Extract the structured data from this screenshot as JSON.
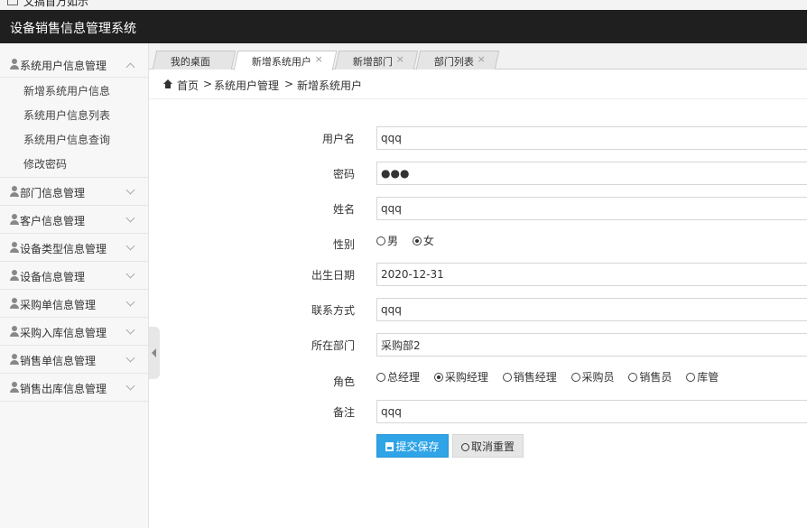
{
  "window": {
    "title": "文搞首万如示"
  },
  "header": {
    "app_title": "设备销售信息管理系统"
  },
  "sidebar": {
    "groups": [
      {
        "label": "系统用户信息管理",
        "expanded": true,
        "items": [
          "新增系统用户信息",
          "系统用户信息列表",
          "系统用户信息查询",
          "修改密码"
        ]
      },
      {
        "label": "部门信息管理"
      },
      {
        "label": "客户信息管理"
      },
      {
        "label": "设备类型信息管理"
      },
      {
        "label": "设备信息管理"
      },
      {
        "label": "采购单信息管理"
      },
      {
        "label": "采购入库信息管理"
      },
      {
        "label": "销售单信息管理"
      },
      {
        "label": "销售出库信息管理"
      }
    ]
  },
  "tabs": [
    {
      "label": "我的桌面",
      "closable": false
    },
    {
      "label": "新增系统用户",
      "closable": true,
      "active": true
    },
    {
      "label": "新增部门",
      "closable": true
    },
    {
      "label": "部门列表",
      "closable": true
    }
  ],
  "tab_close_glyph": "×",
  "breadcrumb": {
    "items": [
      "首页",
      "系统用户管理",
      "新增系统用户"
    ],
    "separator": ">"
  },
  "form": {
    "username": {
      "label": "用户名",
      "value": "qqq"
    },
    "password": {
      "label": "密码",
      "value": "●●●"
    },
    "name": {
      "label": "姓名",
      "value": "qqq"
    },
    "gender": {
      "label": "性别",
      "options": [
        "男",
        "女"
      ],
      "selected": "女"
    },
    "birthdate": {
      "label": "出生日期",
      "value": "2020-12-31"
    },
    "contact": {
      "label": "联系方式",
      "value": "qqq"
    },
    "department": {
      "label": "所在部门",
      "value": "采购部2"
    },
    "role": {
      "label": "角色",
      "options": [
        "总经理",
        "采购经理",
        "销售经理",
        "采购员",
        "销售员",
        "库管"
      ],
      "selected": "采购经理"
    },
    "remark": {
      "label": "备注",
      "value": "qqq"
    }
  },
  "buttons": {
    "submit_label": "提交保存",
    "reset_label": "取消重置"
  },
  "colors": {
    "header_bg": "#1f1f1f",
    "primary": "#2fa4e7",
    "sidebar_bg": "#f7f7f7"
  }
}
